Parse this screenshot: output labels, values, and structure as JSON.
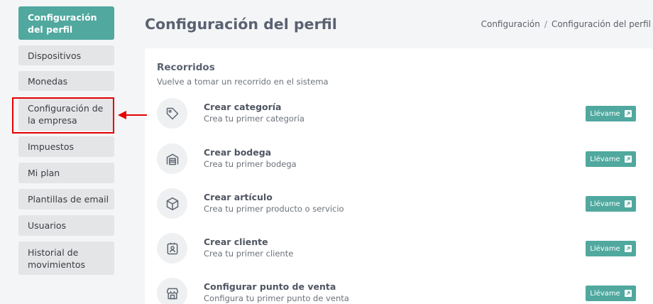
{
  "sidebar": {
    "items": [
      {
        "label": "Configuración del perfil",
        "active": true
      },
      {
        "label": "Dispositivos"
      },
      {
        "label": "Monedas"
      },
      {
        "label": "Configuración de la empresa"
      },
      {
        "label": "Impuestos"
      },
      {
        "label": "Mi plan"
      },
      {
        "label": "Plantillas de email"
      },
      {
        "label": "Usuarios"
      },
      {
        "label": "Historial de movimientos"
      }
    ]
  },
  "header": {
    "title": "Configuración del perfil",
    "breadcrumb": [
      "Configuración",
      "Configuración del perfil"
    ]
  },
  "tours": {
    "title": "Recorridos",
    "subtitle": "Vuelve a tomar un recorrido en el sistema",
    "button_label": "Llévame",
    "items": [
      {
        "title": "Crear categoría",
        "desc": "Crea tu primer categoría",
        "icon": "tag-icon"
      },
      {
        "title": "Crear bodega",
        "desc": "Crea tu primer bodega",
        "icon": "warehouse-icon"
      },
      {
        "title": "Crear artículo",
        "desc": "Crea tu primer producto o servicio",
        "icon": "box-icon"
      },
      {
        "title": "Crear cliente",
        "desc": "Crea tu primer cliente",
        "icon": "contact-icon"
      },
      {
        "title": "Configurar punto de venta",
        "desc": "Configura tu primer punto de venta",
        "icon": "store-icon"
      }
    ]
  },
  "colors": {
    "accent": "#50a89e",
    "highlight": "#e60000"
  }
}
